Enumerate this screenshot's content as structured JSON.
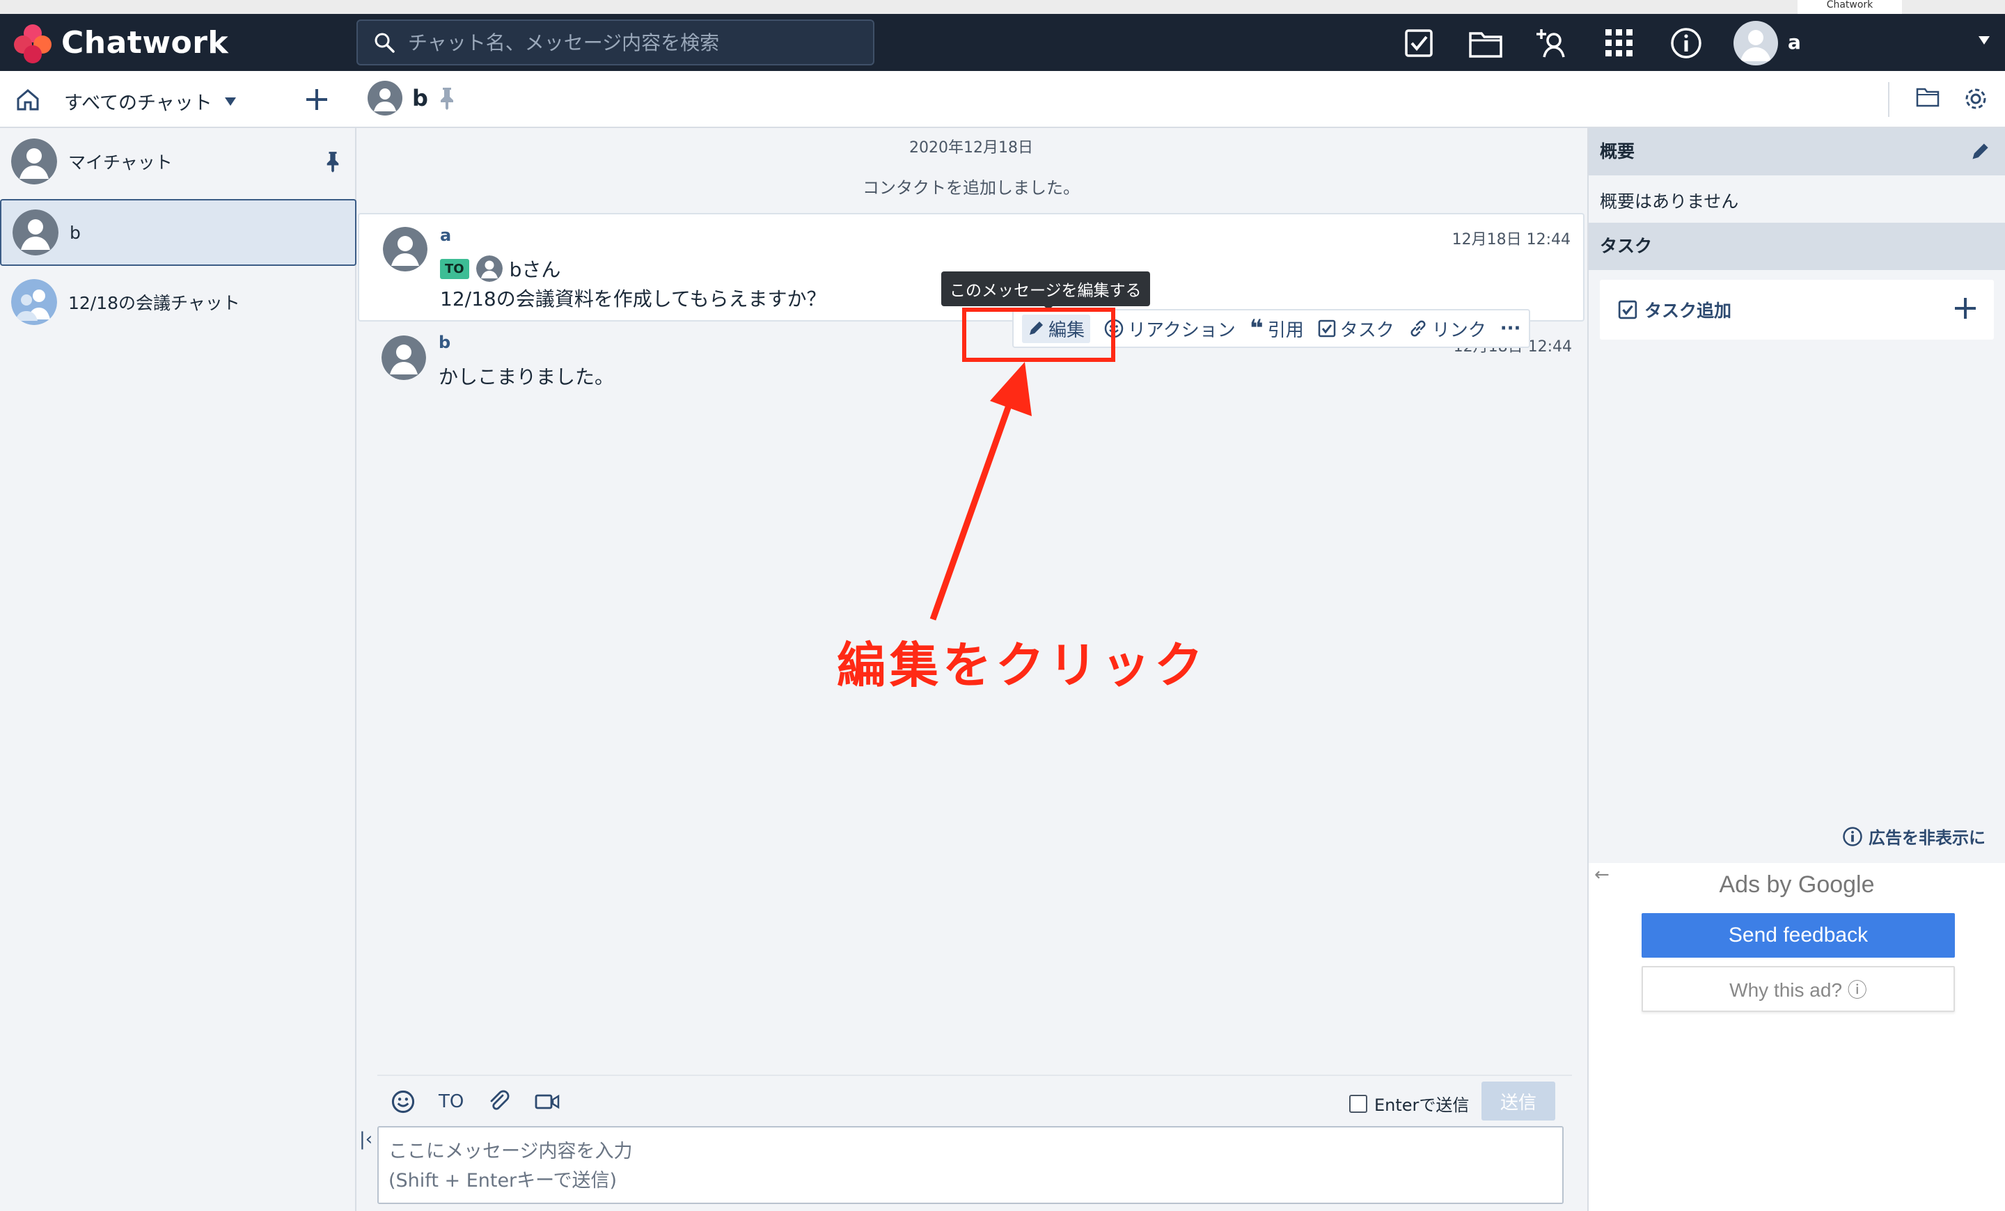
{
  "window": {
    "title": "Chatwork"
  },
  "header": {
    "logo_text": "Chatwork",
    "search_placeholder": "チャット名、メッセージ内容を検索",
    "user_name": "a"
  },
  "subheader": {
    "filter_label": "すべてのチャット",
    "room_name": "b"
  },
  "sidebar": {
    "rooms": [
      {
        "label": "マイチャット",
        "pinned": true
      },
      {
        "label": "b",
        "active": true
      },
      {
        "label": "12/18の会議チャット"
      }
    ]
  },
  "timeline": {
    "date": "2020年12月18日",
    "system_message": "コンタクトを追加しました。",
    "messages": [
      {
        "sender": "a",
        "time": "12月18日 12:44",
        "to_badge": "TO",
        "to_name": "bさん",
        "text": "12/18の会議資料を作成してもらえますか？"
      },
      {
        "sender": "b",
        "time": "12月18日 12:44",
        "text": "かしこまりました。"
      }
    ],
    "tooltip": "このメッセージを編集する",
    "actions": {
      "edit": "編集",
      "reaction": "リアクション",
      "quote": "引用",
      "task": "タスク",
      "link": "リンク",
      "more": "···"
    }
  },
  "annotation": {
    "text": "編集をクリック",
    "color": "#ff2a15"
  },
  "composer": {
    "to_label": "TO",
    "enter_send_label": "Enterで送信",
    "send_label": "送信",
    "placeholder": "ここにメッセージ内容を入力\n(Shift + Enterキーで送信)"
  },
  "right_panel": {
    "overview_title": "概要",
    "overview_empty": "概要はありません",
    "task_title": "タスク",
    "add_task_label": "タスク追加",
    "hide_ads_label": "広告を非表示に",
    "ads_by": "Ads by Google",
    "send_feedback": "Send feedback",
    "why_this_ad": "Why this ad? ⓘ"
  },
  "colors": {
    "header_bg": "#1a2433",
    "accent": "#2d4a70",
    "to_badge": "#3dbd95",
    "feedback_blue": "#3d7fe6"
  }
}
